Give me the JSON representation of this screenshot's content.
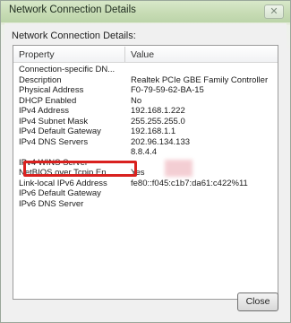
{
  "window": {
    "title": "Network Connection Details",
    "close_glyph": "✕"
  },
  "group_label": "Network Connection Details:",
  "columns": {
    "property": "Property",
    "value": "Value"
  },
  "rows": [
    {
      "property": "Connection-specific DN...",
      "value": ""
    },
    {
      "property": "Description",
      "value": "Realtek PCIe GBE Family Controller"
    },
    {
      "property": "Physical Address",
      "value": "F0-79-59-62-BA-15"
    },
    {
      "property": "DHCP Enabled",
      "value": "No"
    },
    {
      "property": "IPv4 Address",
      "value": "192.168.1.222"
    },
    {
      "property": "IPv4 Subnet Mask",
      "value": "255.255.255.0"
    },
    {
      "property": "IPv4 Default Gateway",
      "value": "192.168.1.1"
    },
    {
      "property": "IPv4 DNS Servers",
      "value": "202.96.134.133"
    },
    {
      "property": "",
      "value": "8.8.4.4"
    },
    {
      "property": "IPv4 WINS Server",
      "value": ""
    },
    {
      "property": "NetBIOS over Tcpip En...",
      "value": "Yes"
    },
    {
      "property": "Link-local IPv6 Address",
      "value": "fe80::f045:c1b7:da61:c422%11"
    },
    {
      "property": "IPv6 Default Gateway",
      "value": ""
    },
    {
      "property": "IPv6 DNS Server",
      "value": ""
    }
  ],
  "buttons": {
    "close": "Close"
  },
  "colors": {
    "highlight_border": "#d9211f",
    "titlebar": "#c7dcb5"
  }
}
